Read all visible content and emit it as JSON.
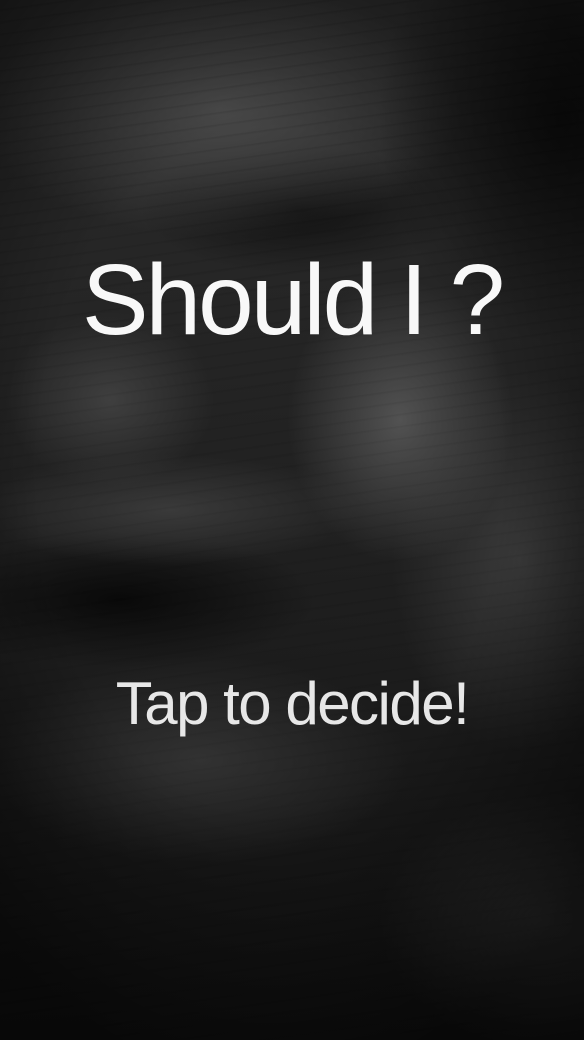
{
  "screen": {
    "question": "Should I ?",
    "tap_hint": "Tap to decide!"
  },
  "background": {
    "description_icon": "portrait-photo",
    "tint": "#1c1c1c"
  }
}
